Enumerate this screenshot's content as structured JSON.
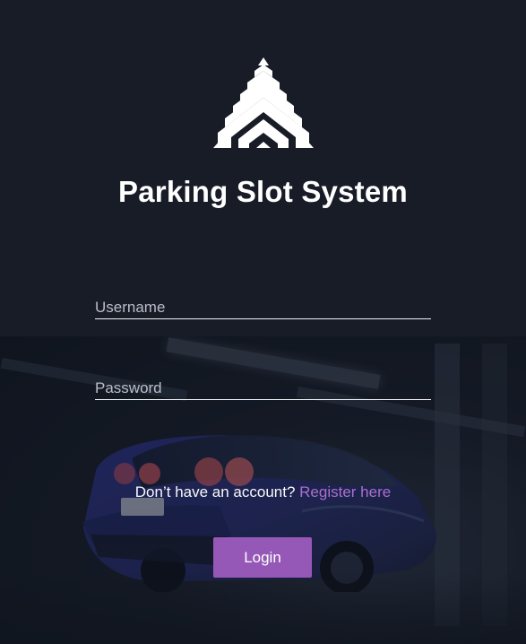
{
  "app": {
    "title": "Parking Slot System"
  },
  "form": {
    "username": {
      "placeholder": "Username",
      "value": ""
    },
    "password": {
      "placeholder": "Password",
      "value": ""
    },
    "register_prompt": "Don’t have an account?",
    "register_link": "Register here",
    "login_button": "Login"
  },
  "icons": {
    "logo": "triangle-chevron-logo-icon"
  },
  "colors": {
    "background": "#181c27",
    "accent": "#9658b6",
    "link": "#a96fd0",
    "text": "#ffffff",
    "placeholder": "#b9bdc8"
  }
}
